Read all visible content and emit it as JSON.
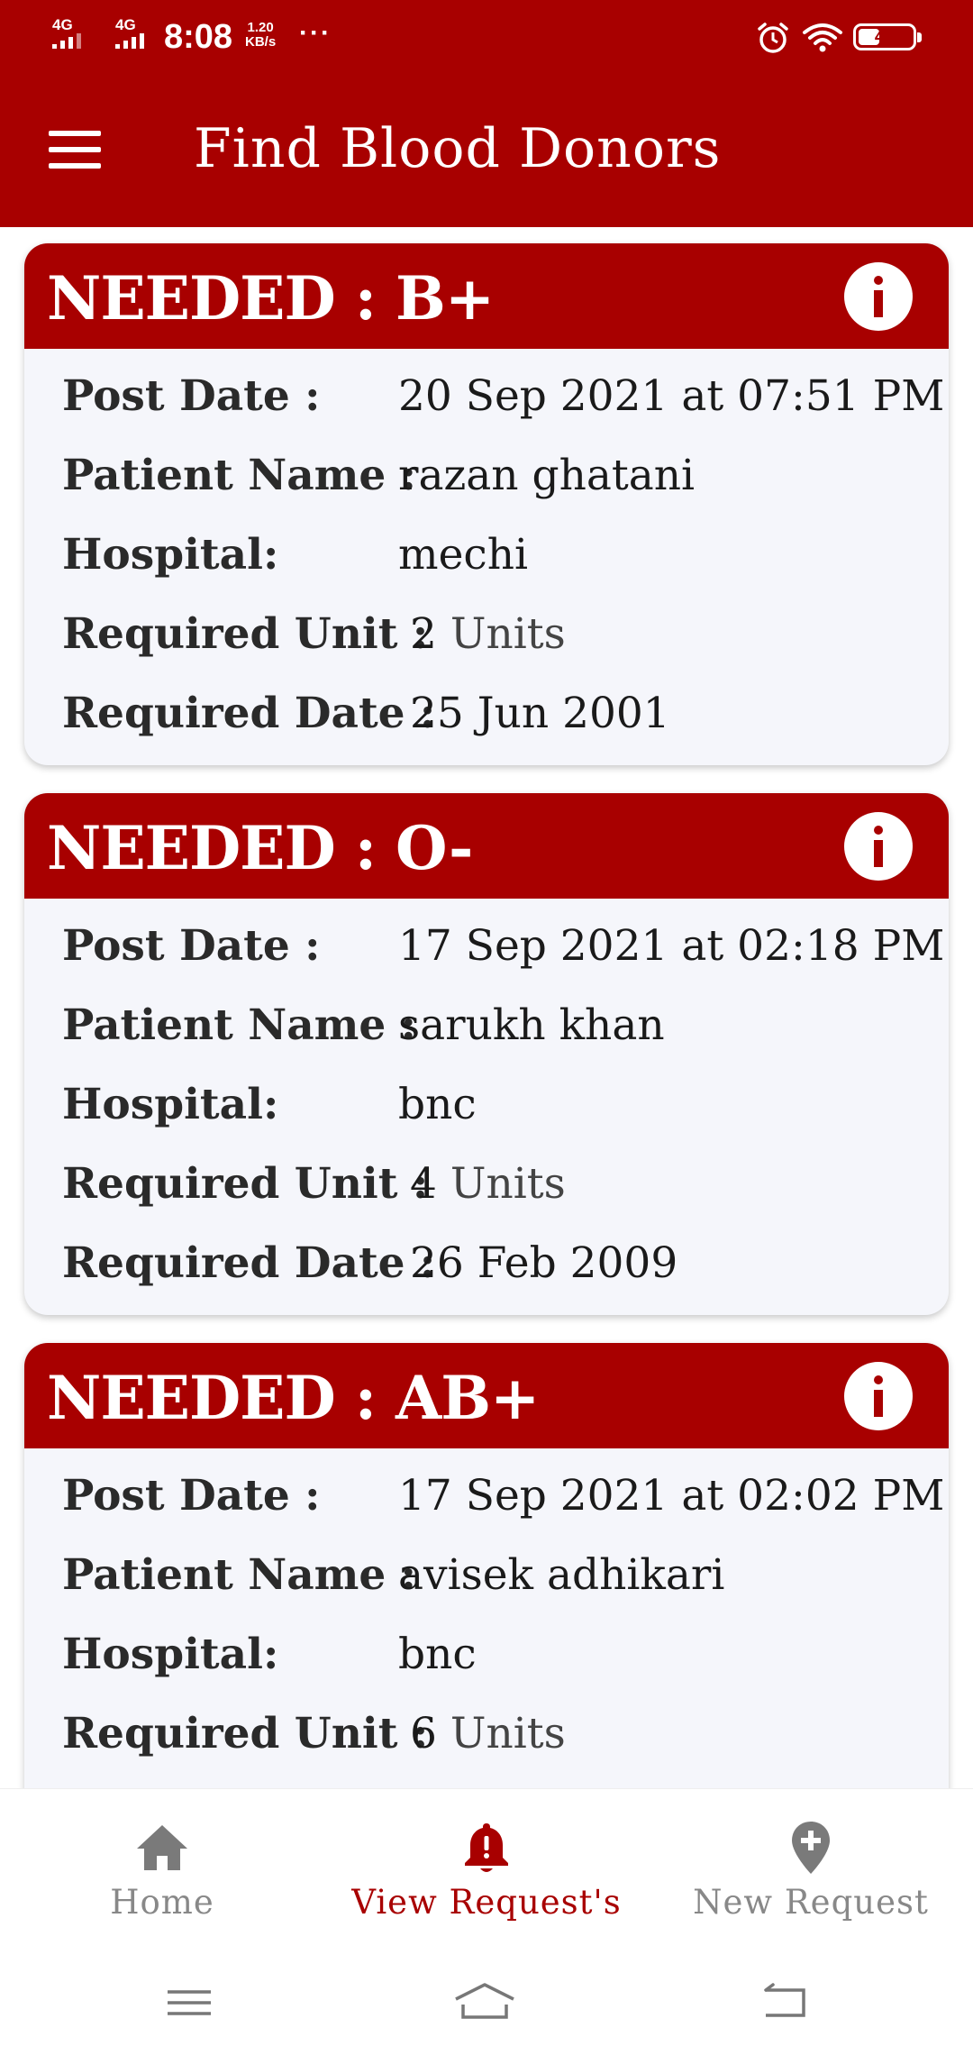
{
  "status_bar": {
    "network1": "4G",
    "network2": "4G",
    "time": "8:08",
    "speed_value": "1.20",
    "speed_unit": "KB/s",
    "more": "···",
    "battery": "40",
    "battery_level": 0.4,
    "icons": [
      "signal-icon",
      "alarm-icon",
      "wifi-icon",
      "battery-icon"
    ]
  },
  "app_bar": {
    "title": "Find Blood Donors",
    "menu_icon": "hamburger-menu-icon"
  },
  "colors": {
    "primary": "#a80000",
    "card_bg": "#f5f6fb",
    "inactive": "#888888"
  },
  "requests": [
    {
      "title": "NEEDED : B+",
      "post_date_label": "Post Date :",
      "post_date": "20 Sep 2021 at 07:51 PM",
      "patient_label": "Patient Name :",
      "patient": "razan ghatani",
      "hospital_label": "Hospital:",
      "hospital": "mechi",
      "unit_label": "Required Unit :",
      "unit_count": "2",
      "unit_text": "Units",
      "date_label": "Required Date :",
      "required_date": "25 Jun 2001"
    },
    {
      "title": "NEEDED : O-",
      "post_date_label": "Post Date :",
      "post_date": "17 Sep 2021 at 02:18 PM",
      "patient_label": "Patient Name :",
      "patient": "sarukh khan",
      "hospital_label": "Hospital:",
      "hospital": "bnc",
      "unit_label": "Required Unit :",
      "unit_count": "4",
      "unit_text": "Units",
      "date_label": "Required Date :",
      "required_date": "26 Feb 2009"
    },
    {
      "title": "NEEDED : AB+",
      "post_date_label": "Post Date :",
      "post_date": "17 Sep 2021 at 02:02 PM",
      "patient_label": "Patient Name :",
      "patient": "avisek adhikari",
      "hospital_label": "Hospital:",
      "hospital": "bnc",
      "unit_label": "Required Unit :",
      "unit_count": "6",
      "unit_text": "Units"
    }
  ],
  "bottom_nav": {
    "items": [
      {
        "label": "Home",
        "icon": "home-icon",
        "active": false
      },
      {
        "label": "View Request's",
        "icon": "bell-alert-icon",
        "active": true
      },
      {
        "label": "New Request",
        "icon": "location-add-icon",
        "active": false
      }
    ]
  },
  "system_nav": {
    "buttons": [
      "recent-apps-icon",
      "home-gesture-icon",
      "back-icon"
    ]
  }
}
